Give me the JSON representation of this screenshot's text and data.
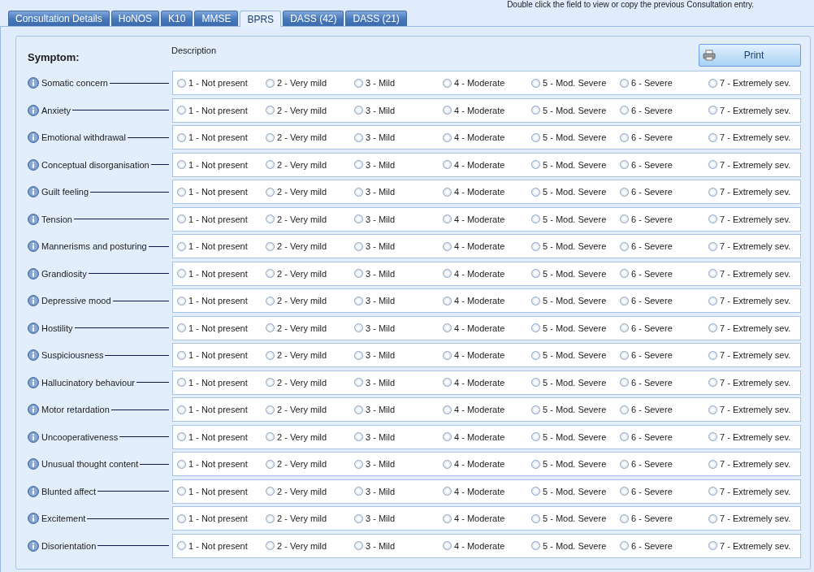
{
  "hint": "Double click the field to view or copy the previous Consultation entry.",
  "tabs": [
    {
      "label": "Consultation Details",
      "selected": false
    },
    {
      "label": "HoNOS",
      "selected": false
    },
    {
      "label": "K10",
      "selected": false
    },
    {
      "label": "MMSE",
      "selected": false
    },
    {
      "label": "BPRS",
      "selected": true
    },
    {
      "label": "DASS (42)",
      "selected": false
    },
    {
      "label": "DASS (21)",
      "selected": false
    }
  ],
  "symptom_heading": "Symptom:",
  "description_heading": "Description",
  "print_button": "Print",
  "rows": [
    {
      "symptom": "Somatic concern",
      "options": [
        {
          "label": "1 - Not present",
          "selected": false
        },
        {
          "label": "2 - Very mild",
          "selected": false
        },
        {
          "label": "3 - Mild",
          "selected": false
        },
        {
          "label": "4 - Moderate",
          "selected": false
        },
        {
          "label": "5 - Mod. Severe",
          "selected": false
        },
        {
          "label": "6 - Severe",
          "selected": false
        },
        {
          "label": "7 - Extremely sev.",
          "selected": false
        }
      ]
    },
    {
      "symptom": "Anxiety",
      "options": [
        {
          "label": "1 - Not present",
          "selected": false
        },
        {
          "label": "2 - Very mild",
          "selected": false
        },
        {
          "label": "3 - Mild",
          "selected": false
        },
        {
          "label": "4 - Moderate",
          "selected": false
        },
        {
          "label": "5 - Mod. Severe",
          "selected": false
        },
        {
          "label": "6 - Severe",
          "selected": false
        },
        {
          "label": "7 - Extremely sev.",
          "selected": false
        }
      ]
    },
    {
      "symptom": "Emotional withdrawal",
      "options": [
        {
          "label": "1 - Not present",
          "selected": false
        },
        {
          "label": "2 - Very mild",
          "selected": false
        },
        {
          "label": "3 - Mild",
          "selected": false
        },
        {
          "label": "4 - Moderate",
          "selected": false
        },
        {
          "label": "5 - Mod. Severe",
          "selected": false
        },
        {
          "label": "6 - Severe",
          "selected": false
        },
        {
          "label": "7 - Extremely sev.",
          "selected": false
        }
      ]
    },
    {
      "symptom": "Conceptual disorganisation",
      "options": [
        {
          "label": "1 - Not present",
          "selected": false
        },
        {
          "label": "2 - Very mild",
          "selected": false
        },
        {
          "label": "3 - Mild",
          "selected": false
        },
        {
          "label": "4 - Moderate",
          "selected": false
        },
        {
          "label": "5 - Mod. Severe",
          "selected": false
        },
        {
          "label": "6 - Severe",
          "selected": false
        },
        {
          "label": "7 - Extremely sev.",
          "selected": false
        }
      ]
    },
    {
      "symptom": "Guilt feeling",
      "options": [
        {
          "label": "1 - Not present",
          "selected": false
        },
        {
          "label": "2 - Very mild",
          "selected": false
        },
        {
          "label": "3 - Mild",
          "selected": false
        },
        {
          "label": "4 - Moderate",
          "selected": false
        },
        {
          "label": "5 - Mod. Severe",
          "selected": false
        },
        {
          "label": "6 - Severe",
          "selected": false
        },
        {
          "label": "7 - Extremely sev.",
          "selected": false
        }
      ]
    },
    {
      "symptom": "Tension",
      "options": [
        {
          "label": "1 - Not present",
          "selected": false
        },
        {
          "label": "2 - Very mild",
          "selected": false
        },
        {
          "label": "3 - Mild",
          "selected": false
        },
        {
          "label": "4 - Moderate",
          "selected": false
        },
        {
          "label": "5 - Mod. Severe",
          "selected": false
        },
        {
          "label": "6 - Severe",
          "selected": false
        },
        {
          "label": "7 - Extremely sev.",
          "selected": false
        }
      ]
    },
    {
      "symptom": "Mannerisms and posturing",
      "options": [
        {
          "label": "1 - Not present",
          "selected": false
        },
        {
          "label": "2 - Very mild",
          "selected": false
        },
        {
          "label": "3 - Mild",
          "selected": false
        },
        {
          "label": "4 - Moderate",
          "selected": false
        },
        {
          "label": "5 - Mod. Severe",
          "selected": false
        },
        {
          "label": "6 - Severe",
          "selected": false
        },
        {
          "label": "7 - Extremely sev.",
          "selected": false
        }
      ]
    },
    {
      "symptom": "Grandiosity",
      "options": [
        {
          "label": "1 - Not present",
          "selected": false
        },
        {
          "label": "2 - Very mild",
          "selected": false
        },
        {
          "label": "3 - Mild",
          "selected": false
        },
        {
          "label": "4 - Moderate",
          "selected": false
        },
        {
          "label": "5 - Mod. Severe",
          "selected": false
        },
        {
          "label": "6 - Severe",
          "selected": false
        },
        {
          "label": "7 - Extremely sev.",
          "selected": false
        }
      ]
    },
    {
      "symptom": "Depressive mood",
      "options": [
        {
          "label": "1 - Not present",
          "selected": false
        },
        {
          "label": "2 - Very mild",
          "selected": false
        },
        {
          "label": "3 - Mild",
          "selected": false
        },
        {
          "label": "4 - Moderate",
          "selected": false
        },
        {
          "label": "5 - Mod. Severe",
          "selected": false
        },
        {
          "label": "6 - Severe",
          "selected": false
        },
        {
          "label": "7 - Extremely sev.",
          "selected": false
        }
      ]
    },
    {
      "symptom": "Hostility",
      "options": [
        {
          "label": "1 - Not present",
          "selected": false
        },
        {
          "label": "2 - Very mild",
          "selected": false
        },
        {
          "label": "3 - Mild",
          "selected": false
        },
        {
          "label": "4 - Moderate",
          "selected": false
        },
        {
          "label": "5 - Mod. Severe",
          "selected": false
        },
        {
          "label": "6 - Severe",
          "selected": false
        },
        {
          "label": "7 - Extremely sev.",
          "selected": false
        }
      ]
    },
    {
      "symptom": "Suspiciousness",
      "options": [
        {
          "label": "1 - Not present",
          "selected": false
        },
        {
          "label": "2 - Very mild",
          "selected": false
        },
        {
          "label": "3 - Mild",
          "selected": false
        },
        {
          "label": "4 - Moderate",
          "selected": false
        },
        {
          "label": "5 - Mod. Severe",
          "selected": false
        },
        {
          "label": "6 - Severe",
          "selected": false
        },
        {
          "label": "7 - Extremely sev.",
          "selected": false
        }
      ]
    },
    {
      "symptom": "Hallucinatory behaviour",
      "options": [
        {
          "label": "1 - Not present",
          "selected": false
        },
        {
          "label": "2 - Very mild",
          "selected": false
        },
        {
          "label": "3 - Mild",
          "selected": false
        },
        {
          "label": "4 - Moderate",
          "selected": false
        },
        {
          "label": "5 - Mod. Severe",
          "selected": false
        },
        {
          "label": "6 - Severe",
          "selected": false
        },
        {
          "label": "7 - Extremely sev.",
          "selected": false
        }
      ]
    },
    {
      "symptom": "Motor retardation",
      "options": [
        {
          "label": "1 - Not present",
          "selected": false
        },
        {
          "label": "2 - Very mild",
          "selected": false
        },
        {
          "label": "3 - Mild",
          "selected": false
        },
        {
          "label": "4 - Moderate",
          "selected": false
        },
        {
          "label": "5 - Mod. Severe",
          "selected": false
        },
        {
          "label": "6 - Severe",
          "selected": false
        },
        {
          "label": "7 - Extremely sev.",
          "selected": false
        }
      ]
    },
    {
      "symptom": "Uncooperativeness",
      "options": [
        {
          "label": "1 - Not present",
          "selected": false
        },
        {
          "label": "2 - Very mild",
          "selected": false
        },
        {
          "label": "3 - Mild",
          "selected": false
        },
        {
          "label": "4 - Moderate",
          "selected": false
        },
        {
          "label": "5 - Mod. Severe",
          "selected": false
        },
        {
          "label": "6 - Severe",
          "selected": false
        },
        {
          "label": "7 - Extremely sev.",
          "selected": false
        }
      ]
    },
    {
      "symptom": "Unusual thought content",
      "options": [
        {
          "label": "1 - Not present",
          "selected": false
        },
        {
          "label": "2 - Very mild",
          "selected": false
        },
        {
          "label": "3 - Mild",
          "selected": false
        },
        {
          "label": "4 - Moderate",
          "selected": false
        },
        {
          "label": "5 - Mod. Severe",
          "selected": false
        },
        {
          "label": "6 - Severe",
          "selected": false
        },
        {
          "label": "7 - Extremely sev.",
          "selected": false
        }
      ]
    },
    {
      "symptom": "Blunted affect",
      "options": [
        {
          "label": "1 - Not present",
          "selected": false
        },
        {
          "label": "2 - Very mild",
          "selected": false
        },
        {
          "label": "3 - Mild",
          "selected": false
        },
        {
          "label": "4 - Moderate",
          "selected": false
        },
        {
          "label": "5 - Mod. Severe",
          "selected": false
        },
        {
          "label": "6 - Severe",
          "selected": false
        },
        {
          "label": "7 - Extremely sev.",
          "selected": false
        }
      ]
    },
    {
      "symptom": "Excitement",
      "options": [
        {
          "label": "1 - Not present",
          "selected": false
        },
        {
          "label": "2 - Very mild",
          "selected": false
        },
        {
          "label": "3 - Mild",
          "selected": false
        },
        {
          "label": "4 - Moderate",
          "selected": false
        },
        {
          "label": "5 - Mod. Severe",
          "selected": false
        },
        {
          "label": "6 - Severe",
          "selected": false
        },
        {
          "label": "7 - Extremely sev.",
          "selected": false
        }
      ]
    },
    {
      "symptom": "Disorientation",
      "options": [
        {
          "label": "1 - Not present",
          "selected": false
        },
        {
          "label": "2 - Very mild",
          "selected": false
        },
        {
          "label": "3 - Mild",
          "selected": false
        },
        {
          "label": "4 - Moderate",
          "selected": false
        },
        {
          "label": "5 - Mod. Severe",
          "selected": false
        },
        {
          "label": "6 - Severe",
          "selected": false
        },
        {
          "label": "7 - Extremely sev.",
          "selected": false
        }
      ]
    }
  ]
}
